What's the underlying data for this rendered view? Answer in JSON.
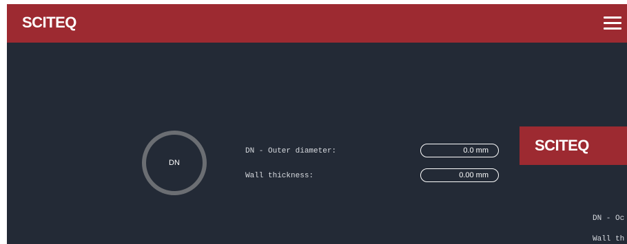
{
  "header": {
    "brand": "SCITEQ",
    "menu_icon": "hamburger-menu-icon"
  },
  "diagram": {
    "circle_label": "DN"
  },
  "fields": [
    {
      "label": "DN - Outer diameter:",
      "value": "0.0 mm"
    },
    {
      "label": "Wall thickness:",
      "value": "0.00 mm"
    }
  ],
  "inset": {
    "brand": "SCITEQ",
    "labels": [
      "DN - Oc",
      "Wall th"
    ]
  },
  "colors": {
    "header_bg": "#9d2a31",
    "app_bg": "#232a36",
    "ring": "#6b6e73"
  }
}
